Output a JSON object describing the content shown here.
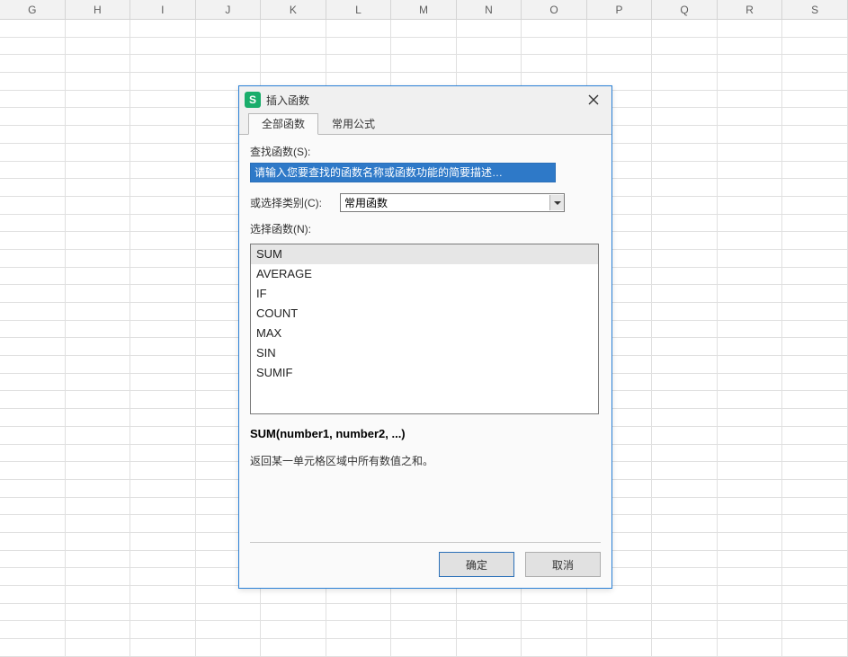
{
  "columns": [
    "G",
    "H",
    "I",
    "J",
    "K",
    "L",
    "M",
    "N",
    "O",
    "P",
    "Q",
    "R",
    "S"
  ],
  "dialog": {
    "title": "插入函数",
    "tabs": [
      "全部函数",
      "常用公式"
    ],
    "search_label": "查找函数(S):",
    "search_value": "请输入您要查找的函数名称或函数功能的简要描述…",
    "category_label": "或选择类别(C):",
    "category_value": "常用函数",
    "select_label": "选择函数(N):",
    "functions": [
      "SUM",
      "AVERAGE",
      "IF",
      "COUNT",
      "MAX",
      "SIN",
      "SUMIF"
    ],
    "selected_index": 0,
    "signature": "SUM(number1, number2, ...)",
    "description": "返回某一单元格区域中所有数值之和。",
    "ok": "确定",
    "cancel": "取消"
  }
}
